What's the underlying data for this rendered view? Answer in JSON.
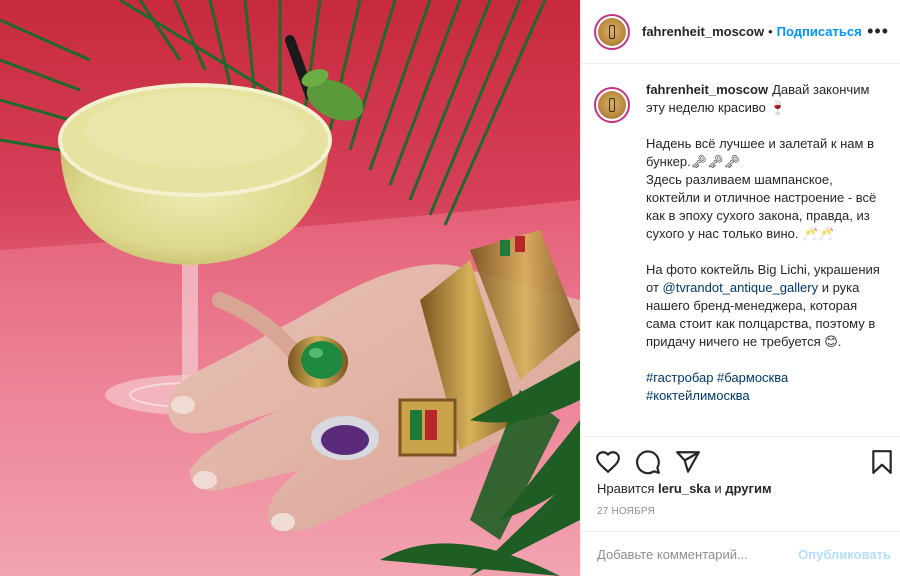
{
  "colors": {
    "accent": "#0095f6",
    "link": "#00376b",
    "text": "#262626",
    "muted": "#8e8e8e",
    "publish_disabled": "#b2dffc",
    "photo_background": "#d6405a"
  },
  "photo": {
    "subject": "cocktail-and-jeweled-hand"
  },
  "header": {
    "username": "fahrenheit_moscow",
    "separator": "•",
    "follow_label": "Подписаться",
    "more_icon": "more-options-icon",
    "more_label": "•••"
  },
  "caption": {
    "username": "fahrenheit_moscow",
    "line1": "Давай закончим эту неделю красиво 🍷",
    "para2": "Надень всё лучшее и залетай к нам в бункер.🗝🗝🗝\nЗдесь разливаем шампанское, коктейли и отличное настроение - всё как в эпоху сухого закона, правда, из сухого у нас только вино. 🥂🥂",
    "para3_before": "На фото коктейль Big Lichi, украшения от ",
    "para3_link": "@tvrandot_antique_gallery",
    "para3_after": " и рука нашего бренд-менеджера, которая сама стоит как полцарства, поэтому в придачу ничего не требуется 😊.",
    "hashtags": "#гастробар #бармосква #коктейлимосква"
  },
  "actions": {
    "like_icon": "heart-icon",
    "comment_icon": "comment-icon",
    "share_icon": "share-icon",
    "save_icon": "bookmark-icon"
  },
  "likes": {
    "prefix": "Нравится",
    "user": "leru_ska",
    "middle": "и",
    "others": "другим"
  },
  "date": "27 НОЯБРЯ",
  "comment": {
    "placeholder": "Добавьте комментарий...",
    "publish_label": "Опубликовать"
  }
}
